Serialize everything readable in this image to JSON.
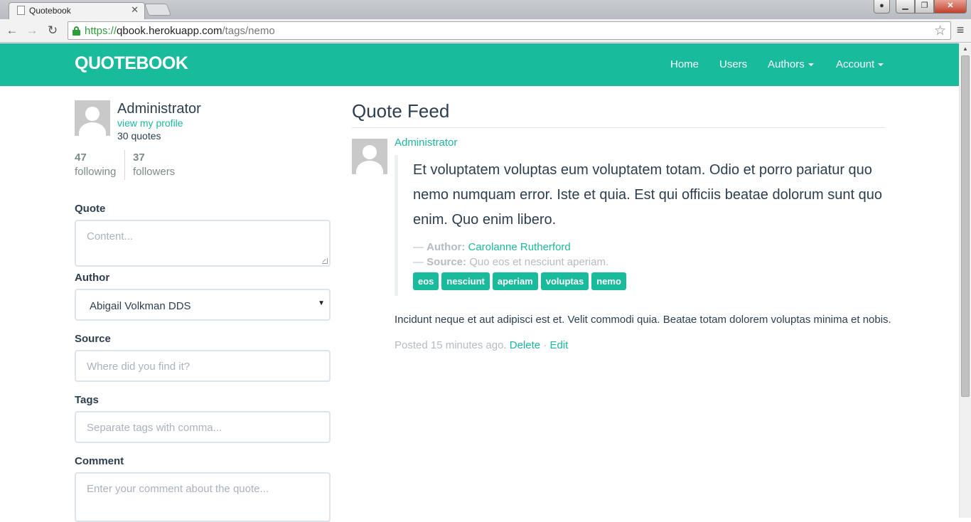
{
  "browser": {
    "tab_title": "Quotebook",
    "url_scheme": "https://",
    "url_host": "qbook.herokuapp.com",
    "url_path": "/tags/nemo",
    "icons": [
      "page-icon",
      "close-icon",
      "back-icon",
      "forward-icon",
      "reload-icon",
      "lock-icon",
      "star-icon",
      "menu-icon"
    ]
  },
  "navbar": {
    "brand": "QUOTEBOOK",
    "home": "Home",
    "users": "Users",
    "authors": "Authors",
    "account": "Account",
    "color": "#18bc9c"
  },
  "profile": {
    "name": "Administrator",
    "view_profile": "view my profile",
    "quotes": "30 quotes",
    "following_count": "47",
    "following_label": "following",
    "followers_count": "37",
    "followers_label": "followers"
  },
  "form": {
    "quote_label": "Quote",
    "content_placeholder": "Content...",
    "author_label": "Author",
    "author_selected": "Abigail Volkman DDS",
    "source_label": "Source",
    "source_placeholder": "Where did you find it?",
    "tags_label": "Tags",
    "tags_placeholder": "Separate tags with comma...",
    "comment_label": "Comment",
    "comment_placeholder": "Enter your comment about the quote..."
  },
  "feed": {
    "title": "Quote Feed",
    "quote": {
      "user": "Administrator",
      "text": "Et voluptatem voluptas eum voluptatem totam. Odio et porro pariatur quo nemo numquam error. Iste et quia. Est qui officiis beatae dolorum sunt quo enim. Quo enim libero.",
      "author_prefix": "— ",
      "author_label": "Author:",
      "author_name": "Carolanne Rutherford",
      "source_prefix": "— ",
      "source_label": "Source:",
      "source_text": "Quo eos et nesciunt aperiam.",
      "tags": [
        "eos",
        "nesciunt",
        "aperiam",
        "voluptas",
        "nemo"
      ],
      "comment": "Incidunt neque et aut adipisci est et. Velit commodi quia. Beatae totam dolorem voluptas minima et nobis.",
      "posted": "Posted 15 minutes ago.",
      "delete": "Delete",
      "separator": "·",
      "edit": "Edit"
    }
  }
}
